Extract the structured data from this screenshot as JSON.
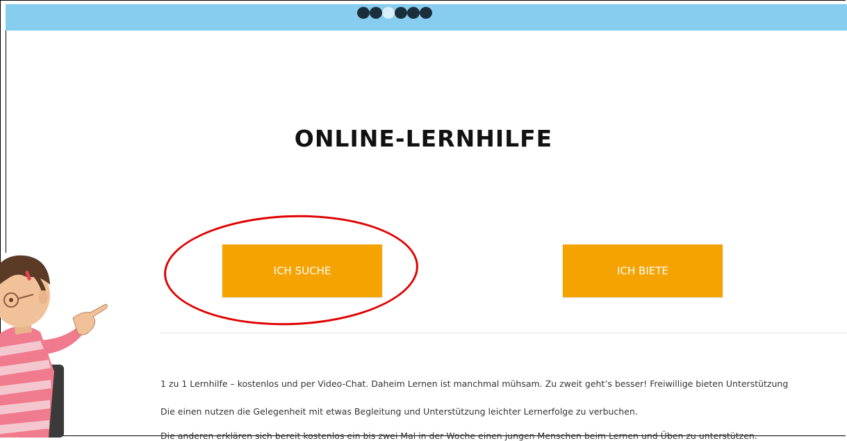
{
  "header": {
    "slider_dots": [
      {
        "state": "inactive"
      },
      {
        "state": "inactive"
      },
      {
        "state": "active"
      },
      {
        "state": "inactive"
      },
      {
        "state": "inactive"
      },
      {
        "state": "inactive"
      }
    ],
    "bar_color": "#86cdef"
  },
  "main": {
    "title": "ONLINE-LERNHILFE",
    "buttons": {
      "search_label": "ICH SUCHE",
      "offer_label": "ICH BIETE"
    },
    "button_color": "#f5a300",
    "annotation_color": "#e00000",
    "paragraphs": [
      "1 zu 1 Lernhilfe – kostenlos und per Video-Chat. Daheim Lernen ist manchmal mühsam. Zu zweit geht’s besser! Freiwillige bieten Unterstützung",
      "Die einen nutzen die Gelegenheit mit etwas Begleitung und Unterstützung leichter Lernerfolge zu verbuchen.",
      "Die anderen erklären sich bereit kostenlos ein bis zwei Mal in der Woche einen jungen Menschen beim Lernen und Üben zu unterstützen."
    ]
  },
  "illustration": {
    "name": "pointing-cartoon-character"
  }
}
